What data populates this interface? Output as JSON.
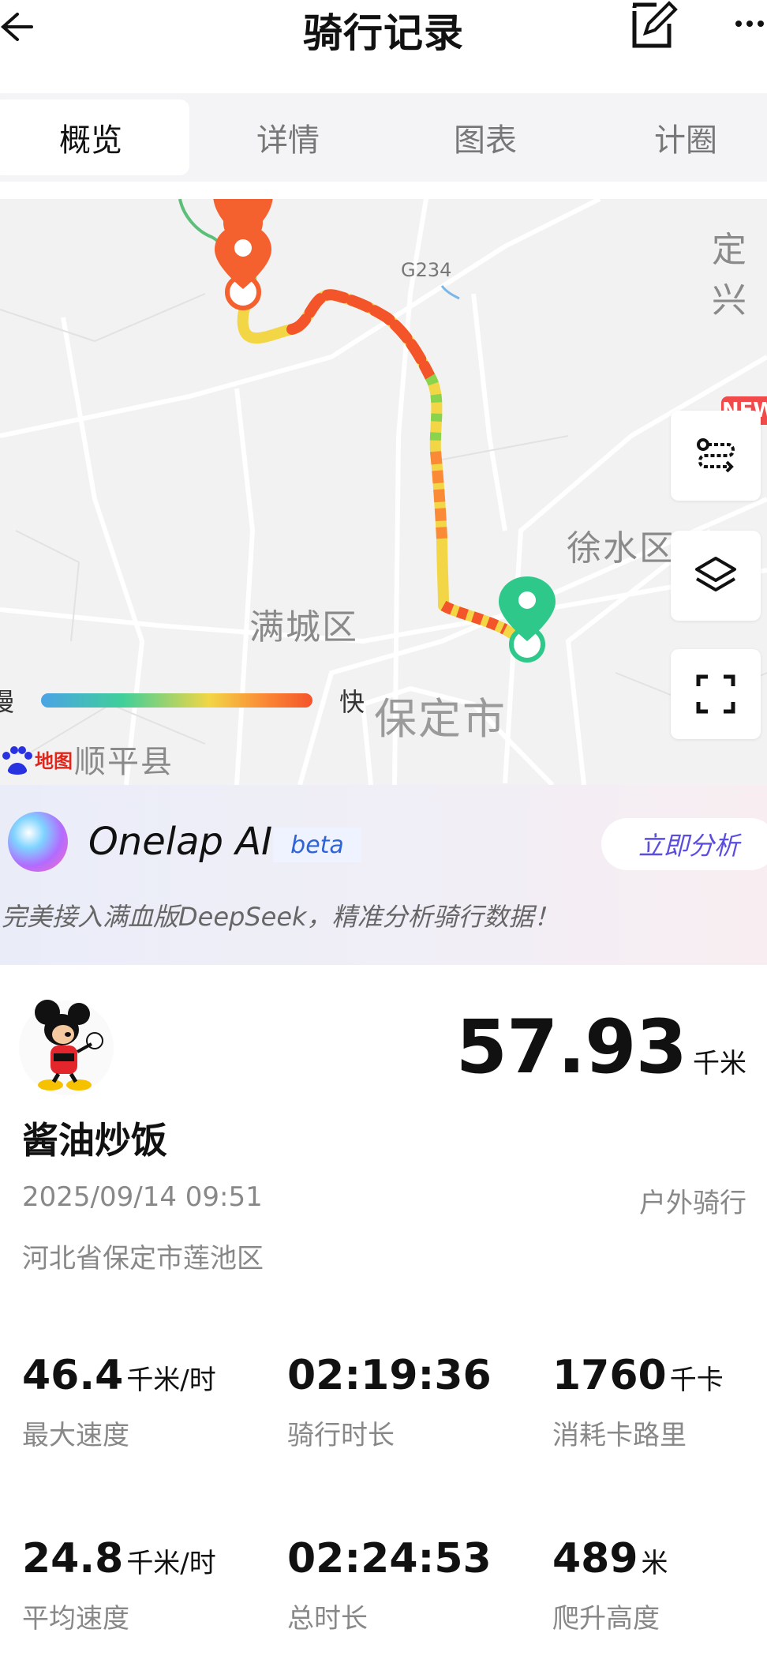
{
  "header": {
    "title": "骑行记录"
  },
  "tabs": [
    {
      "label": "概览",
      "active": true
    },
    {
      "label": "详情",
      "active": false
    },
    {
      "label": "图表",
      "active": false
    },
    {
      "label": "计圈",
      "active": false
    }
  ],
  "map": {
    "labels": {
      "road": "G234",
      "dingxing": "定兴",
      "xushui": "徐水区",
      "mancheng": "满城区",
      "baoding": "保定市",
      "shunping": "顺平县"
    },
    "legend": {
      "slow": "慢",
      "fast": "快"
    },
    "provider": "地图",
    "new_badge": "NEW",
    "start_marker_color": "#2ec98a",
    "end_marker_color": "#f4602e",
    "controls": [
      "route-icon",
      "layers-icon",
      "fullscreen-icon"
    ]
  },
  "ai": {
    "name": "Onelap AI",
    "badge": "beta",
    "button": "立即分析",
    "description": "完美接入满血版DeepSeek，精准分析骑行数据！"
  },
  "summary": {
    "distance": "57.93",
    "distance_unit": "千米",
    "username": "酱油炒饭",
    "datetime": "2025/09/14 09:51",
    "ride_type": "户外骑行",
    "location": "河北省保定市莲池区"
  },
  "stats": [
    {
      "value": "46.4",
      "unit": "千米/时",
      "label": "最大速度"
    },
    {
      "value": "02:19:36",
      "unit": "",
      "label": "骑行时长"
    },
    {
      "value": "1760",
      "unit": "千卡",
      "label": "消耗卡路里"
    },
    {
      "value": "24.8",
      "unit": "千米/时",
      "label": "平均速度"
    },
    {
      "value": "02:24:53",
      "unit": "",
      "label": "总时长"
    },
    {
      "value": "489",
      "unit": "米",
      "label": "爬升高度"
    }
  ],
  "colors": {
    "accent": "#5a4de0",
    "track_fast": "#f4542a",
    "track_slow": "#3fcf9a"
  }
}
